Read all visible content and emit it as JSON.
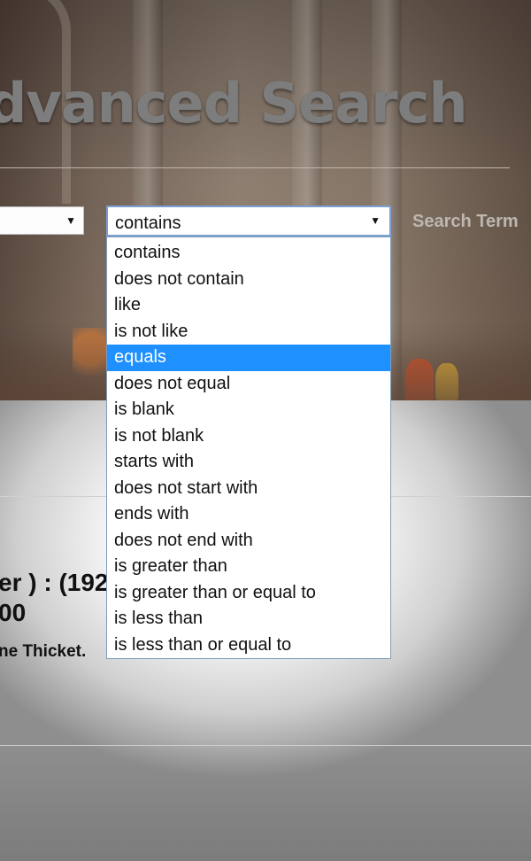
{
  "header": {
    "title": "dvanced Search"
  },
  "search_form": {
    "field_select_value": "",
    "operator_select_value": "contains",
    "search_term_label": "Search Term"
  },
  "operator_options": [
    "contains",
    "does not contain",
    "like",
    "is not like",
    "equals",
    "does not equal",
    "is blank",
    "is not blank",
    "starts with",
    "does not start with",
    "ends with",
    "does not end with",
    "is greater than",
    "is greater than or equal to",
    "is less than",
    "is less than or equal to"
  ],
  "highlighted_option": "equals",
  "results": {
    "line1": "er ) : (192",
    "line2": "00",
    "line3": "ne Thicket."
  },
  "colors": {
    "highlight": "#1e90ff",
    "select_border": "#7b9fd1"
  }
}
